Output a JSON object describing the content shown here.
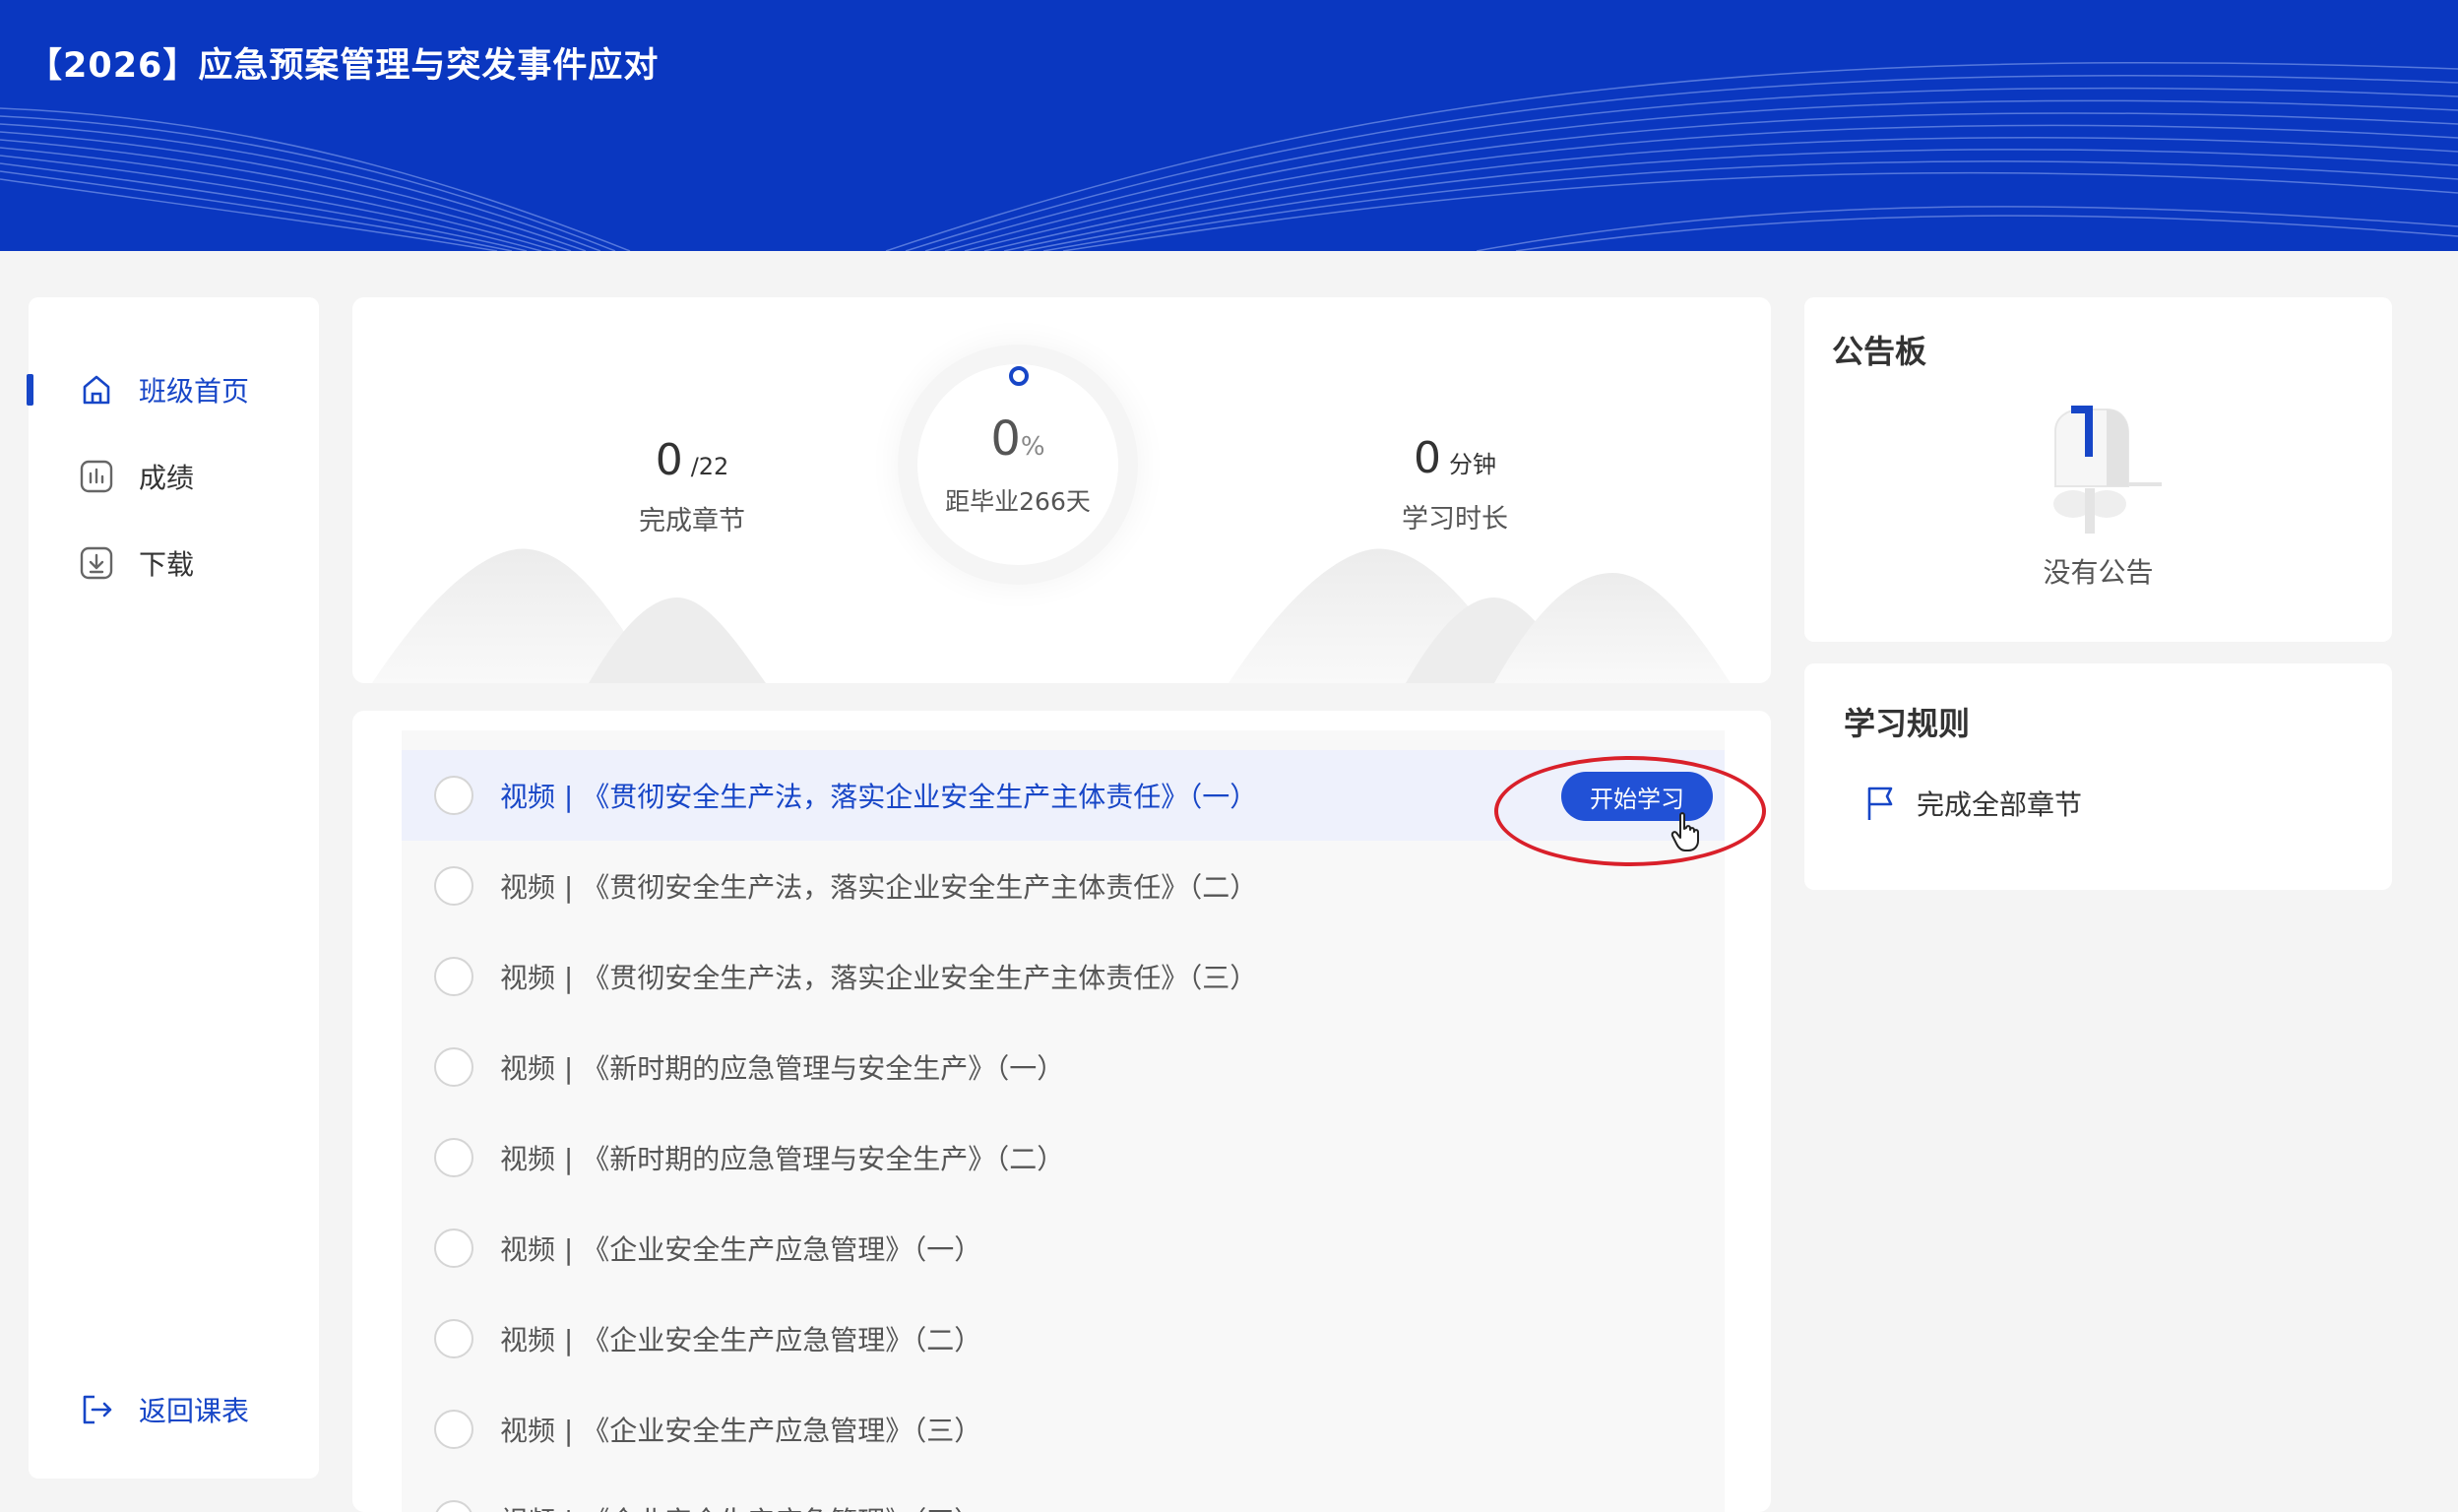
{
  "course": {
    "title": "【2026】应急预案管理与突发事件应对"
  },
  "sidebar": {
    "items": [
      {
        "label": "班级首页",
        "icon": "home-icon",
        "active": true
      },
      {
        "label": "成绩",
        "icon": "chart-icon",
        "active": false
      },
      {
        "label": "下载",
        "icon": "download-icon",
        "active": false
      }
    ],
    "back": {
      "label": "返回课表",
      "icon": "exit-icon"
    }
  },
  "stats": {
    "chapters": {
      "value": "0",
      "total": "/22",
      "label": "完成章节"
    },
    "progress": {
      "value": "0",
      "unit": "%",
      "label": "距毕业266天"
    },
    "duration": {
      "value": "0",
      "unit": "分钟",
      "label": "学习时长"
    }
  },
  "chapters": {
    "start_label": "开始学习",
    "items": [
      "视频 | 《贯彻安全生产法，落实企业安全生产主体责任》（一）",
      "视频 | 《贯彻安全生产法，落实企业安全生产主体责任》（二）",
      "视频 | 《贯彻安全生产法，落实企业安全生产主体责任》（三）",
      "视频 | 《新时期的应急管理与安全生产》（一）",
      "视频 | 《新时期的应急管理与安全生产》（二）",
      "视频 | 《企业安全生产应急管理》（一）",
      "视频 | 《企业安全生产应急管理》（二）",
      "视频 | 《企业安全生产应急管理》（三）",
      "视频 | 《企业安全生产应急管理》（四）"
    ]
  },
  "notice": {
    "title": "公告板",
    "empty_text": "没有公告",
    "icon": "mailbox-icon"
  },
  "rules": {
    "title": "学习规则",
    "items": [
      {
        "label": "完成全部章节",
        "icon": "flag-icon"
      }
    ]
  },
  "colors": {
    "brand": "#0a37c0",
    "accent": "#1746c7",
    "button": "#2151d6",
    "highlight": "#d9202a"
  }
}
